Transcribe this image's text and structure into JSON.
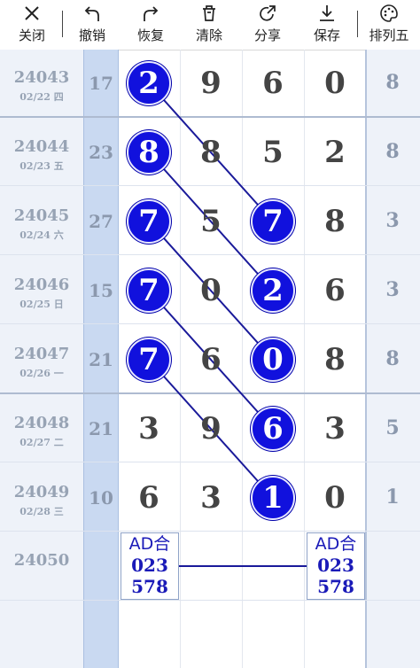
{
  "toolbar": {
    "items": [
      {
        "label": "关闭",
        "icon": "close-icon"
      },
      {
        "label": "撤销",
        "icon": "undo-icon"
      },
      {
        "label": "恢复",
        "icon": "redo-icon"
      },
      {
        "label": "清除",
        "icon": "clear-icon"
      },
      {
        "label": "分享",
        "icon": "share-icon"
      },
      {
        "label": "保存",
        "icon": "save-icon"
      },
      {
        "label": "排列五",
        "icon": "palette-icon"
      }
    ]
  },
  "rows": [
    {
      "period": "24043",
      "date": "02/22 四",
      "sum": "17",
      "digits": [
        "2",
        "9",
        "6",
        "0"
      ],
      "last": "8"
    },
    {
      "period": "24044",
      "date": "02/23 五",
      "sum": "23",
      "digits": [
        "8",
        "8",
        "5",
        "2"
      ],
      "last": "8"
    },
    {
      "period": "24045",
      "date": "02/24 六",
      "sum": "27",
      "digits": [
        "7",
        "5",
        "7",
        "8"
      ],
      "last": "3"
    },
    {
      "period": "24046",
      "date": "02/25 日",
      "sum": "15",
      "digits": [
        "7",
        "0",
        "2",
        "6"
      ],
      "last": "3"
    },
    {
      "period": "24047",
      "date": "02/26 一",
      "sum": "21",
      "digits": [
        "7",
        "6",
        "0",
        "8"
      ],
      "last": "8"
    },
    {
      "period": "24048",
      "date": "02/27 二",
      "sum": "21",
      "digits": [
        "3",
        "9",
        "6",
        "3"
      ],
      "last": "5"
    },
    {
      "period": "24049",
      "date": "02/28 三",
      "sum": "10",
      "digits": [
        "6",
        "3",
        "1",
        "0"
      ],
      "last": "1"
    }
  ],
  "next_period": "24050",
  "prediction": {
    "left": {
      "title": "AD合",
      "line1": "023",
      "line2": "578"
    },
    "right": {
      "title": "AD合",
      "line1": "023",
      "line2": "578"
    }
  },
  "colors": {
    "ball": "#1111dd",
    "line": "#1a1a9a",
    "sum_column": "#c9d9f1"
  }
}
